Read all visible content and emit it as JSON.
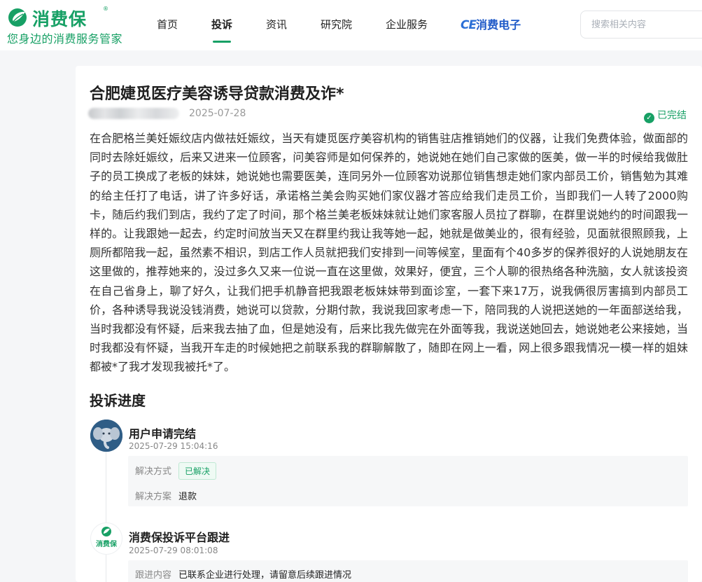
{
  "brand": {
    "name": "消费保",
    "registered": "®",
    "slogan": "您身边的消费服务管家",
    "color": "#17a065"
  },
  "nav": {
    "items": [
      {
        "label": "首页"
      },
      {
        "label": "投诉"
      },
      {
        "label": "资讯"
      },
      {
        "label": "研究院"
      },
      {
        "label": "企业服务"
      }
    ],
    "active_index": 1,
    "ce_mark": "CE",
    "ce_label": "消费电子"
  },
  "search": {
    "placeholder": "搜索相关内容"
  },
  "complaint": {
    "title": "合肥婕觅医疗美容诱导贷款消费及诈*",
    "date": "2025-07-28",
    "status": "已完结",
    "content": "在合肥格兰美妊娠纹店内做祛妊娠纹，当天有婕觅医疗美容机构的销售驻店推销她们的仪器，让我们免费体验，做面部的同时去除妊娠纹，后来又进来一位顾客，问美容师是如何保养的，她说她在她们自己家做的医美，做一半的时候给我做肚子的员工换成了老板的妹妹，她说她也需要医美，连同另外一位顾客劝说那位销售想走她们家内部员工价，销售勉为其难的给主任打了电话，讲了许多好话，承诺格兰美会购买她们家仪器才答应给我们走员工价，当即我们一人转了2000购卡，随后约我们到店，我约了定了时间，那个格兰美老板妹妹就让她们家客服人员拉了群聊，在群里说她约的时间跟我一样的。让我跟她一起去，约定时间放当天又在群里约我让我等她一起，她就是做美业的，很有经验，见面就很照顾我，上厕所都陪我一起，虽然素不相识，到店工作人员就把我们安排到一间等候室，里面有个40多岁的保养很好的人说她朋友在这里做的，推荐她来的，没过多久又来一位说一直在这里做，效果好，便宜，三个人聊的很热络各种洗脑，女人就该投资在自己省身上，聊了好久，让我们把手机静音把我跟老板妹妹带到面诊室，一套下来17万，说我俩很厉害搞到内部员工价，各种诱导我说没钱消费，她说可以贷款，分期付款，我说我回家考虑一下，陪同我的人说把送她的一年面部送给我，当时我都没有怀疑，后来我去抽了血，但是她没有，后来比我先做完在外面等我，我说送她回去，她说她老公来接她，当时我都没有怀疑，当我开车走的时候她把之前联系我的群聊解散了，随即在网上一看，网上很多跟我情况一模一样的姐妹都被*了我才发现我被托*了。"
  },
  "progress": {
    "title": "投诉进度",
    "entries": [
      {
        "actor": "用户申请完结",
        "time": "2025-07-29 15:04:16",
        "method_label": "解决方式",
        "method_value": "已解决",
        "plan_label": "解决方案",
        "plan_value": "退款"
      },
      {
        "actor": "消费保投诉平台跟进",
        "time": "2025-07-29 08:01:08",
        "avatar_text": "消费保",
        "detail_label": "跟进内容",
        "detail_value": "已联系企业进行处理，请留意后续跟进情况"
      }
    ]
  }
}
